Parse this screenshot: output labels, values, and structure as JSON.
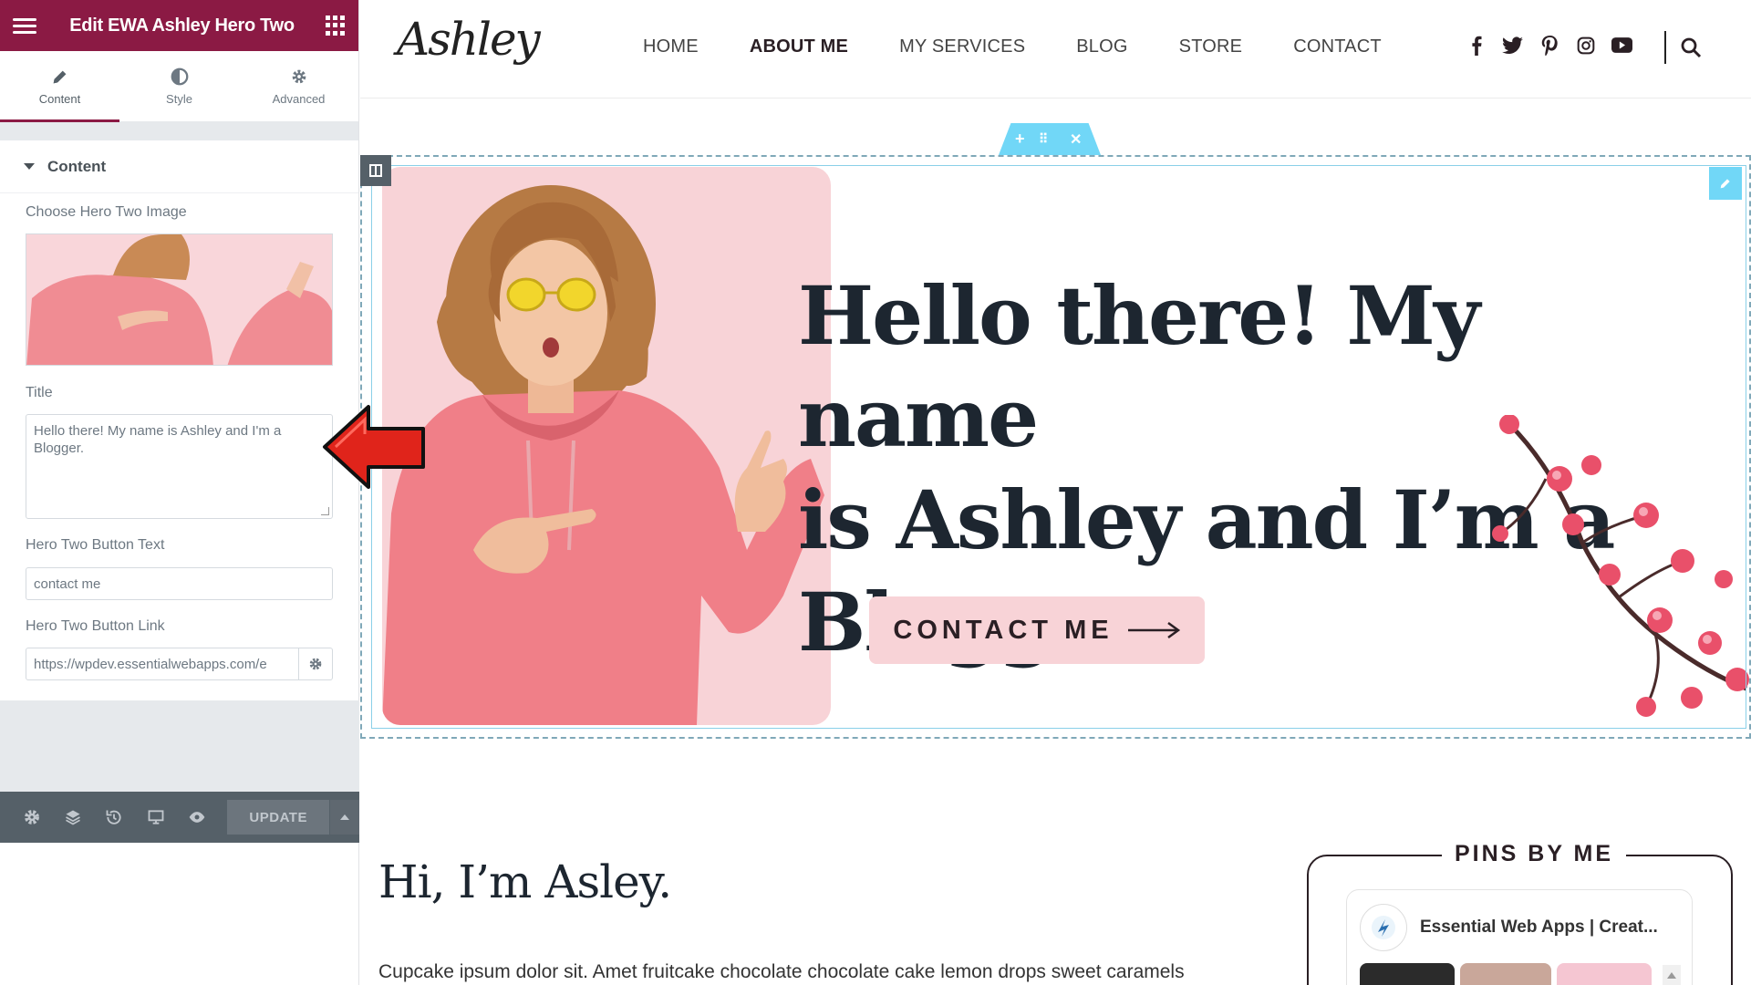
{
  "editor": {
    "title": "Edit EWA Ashley Hero Two",
    "tabs": [
      {
        "label": "Content",
        "icon": "pencil-icon"
      },
      {
        "label": "Style",
        "icon": "contrast-icon"
      },
      {
        "label": "Advanced",
        "icon": "gear-icon"
      }
    ],
    "section_label": "Content",
    "image_label": "Choose Hero Two Image",
    "title_label": "Title",
    "title_value": "Hello there! My name is Ashley and I'm a Blogger.",
    "button_text_label": "Hero Two Button Text",
    "button_text_value": "contact me",
    "button_link_label": "Hero Two Button Link",
    "button_link_value": "https://wpdev.essentialwebapps.com/e",
    "update_label": "UPDATE",
    "accent_color": "#8b1a44"
  },
  "site": {
    "logo": "Ashley",
    "nav": [
      "HOME",
      "ABOUT ME",
      "MY SERVICES",
      "BLOG",
      "STORE",
      "CONTACT"
    ],
    "active_nav": "ABOUT ME",
    "social": [
      "facebook-icon",
      "twitter-icon",
      "pinterest-icon",
      "instagram-icon",
      "youtube-icon"
    ],
    "hero": {
      "heading_lines": [
        "Hello there! My name",
        "is Ashley and I’m a",
        "Blogger."
      ],
      "button_label": "CONTACT ME",
      "pink_color": "#f8d3d7"
    },
    "about": {
      "heading": "Hi, I’m Asley.",
      "text": "Cupcake ipsum dolor sit. Amet fruitcake chocolate chocolate cake lemon drops sweet caramels"
    },
    "pins": {
      "title": "PINS BY ME",
      "profile_name": "Essential Web Apps | Creat..."
    }
  }
}
